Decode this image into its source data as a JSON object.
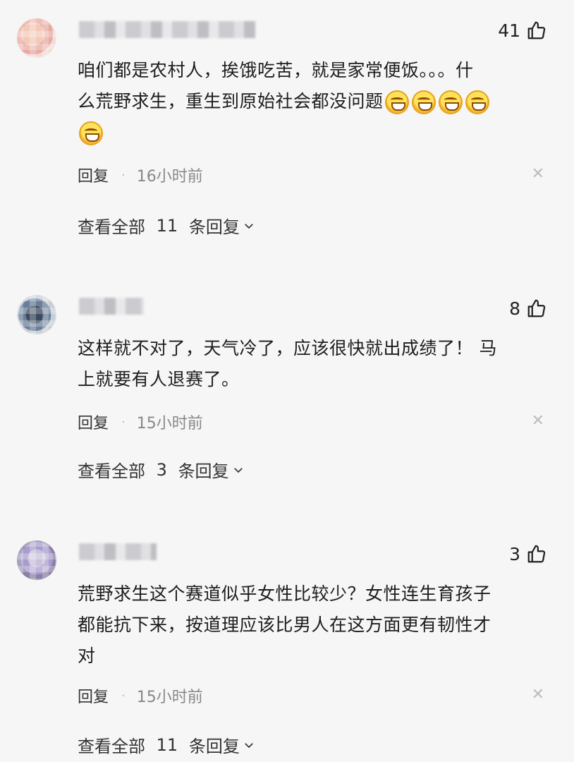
{
  "comments": [
    {
      "likes": "41",
      "text_line1": "咱们都是农村人，挨饿吃苦，就是家常便饭。。。什",
      "text_line2": "么荒野求生，重生到原始社会都没问题",
      "reply_label": "回复",
      "time": "16小时前",
      "view_prefix": "查看全部",
      "view_count": "11",
      "view_suffix": "条回复",
      "emoji_name": "grin-emoji"
    },
    {
      "likes": "8",
      "text_line1": "这样就不对了，天气冷了，应该很快就出成绩了！ 马",
      "text_line2": "上就要有人退赛了。",
      "reply_label": "回复",
      "time": "15小时前",
      "view_prefix": "查看全部",
      "view_count": "3",
      "view_suffix": "条回复"
    },
    {
      "likes": "3",
      "text_line1": "荒野求生这个赛道似乎女性比较少？女性连生育孩子",
      "text_line2": "都能抗下来，按道理应该比男人在这方面更有韧性才",
      "text_line3": "对",
      "reply_label": "回复",
      "time": "15小时前",
      "view_prefix": "查看全部",
      "view_count": "11",
      "view_suffix": "条回复"
    }
  ],
  "icons": {
    "like": "thumbs-up-icon",
    "close": "close-icon",
    "expand": "chevron-down-icon"
  },
  "colors": {
    "background": "#f6f6f6",
    "text": "#1d1d1d",
    "muted": "#888888"
  }
}
